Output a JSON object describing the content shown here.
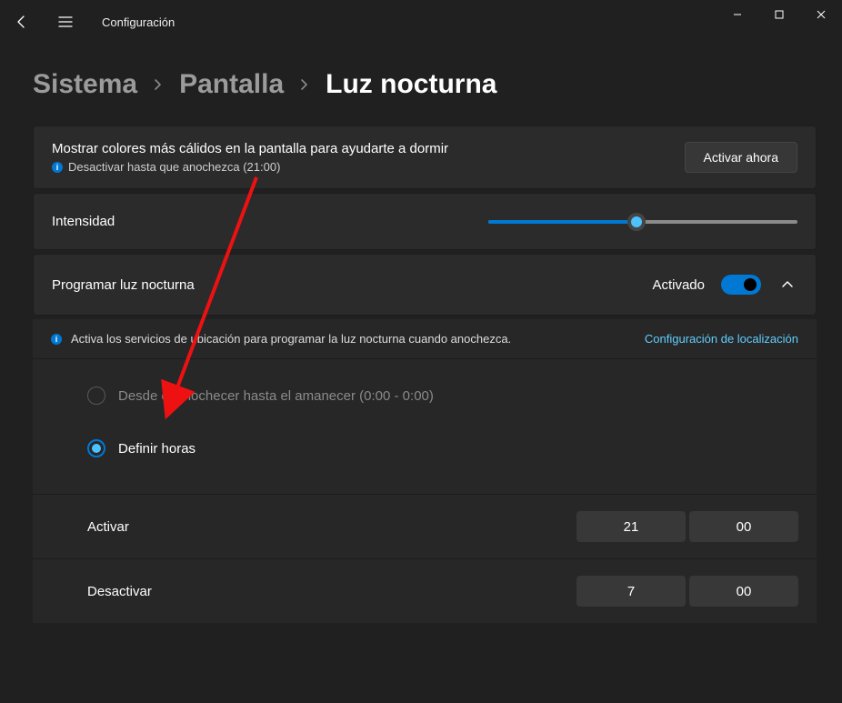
{
  "window": {
    "title": "Configuración"
  },
  "breadcrumb": {
    "system": "Sistema",
    "display": "Pantalla",
    "nightlight": "Luz nocturna"
  },
  "intro": {
    "line1": "Mostrar colores más cálidos en la pantalla para ayudarte a dormir",
    "line2": "Desactivar hasta que anochezca (21:00)",
    "button": "Activar ahora"
  },
  "strength": {
    "label": "Intensidad",
    "value_pct": 48
  },
  "schedule": {
    "label": "Programar luz nocturna",
    "state": "Activado",
    "info_text": "Activa los servicios de ubicación para programar la luz nocturna cuando anochezca.",
    "info_link": "Configuración de localización",
    "option_sunset": "Desde el anochecer hasta el amanecer (0:00 - 0:00)",
    "option_hours": "Definir horas"
  },
  "times": {
    "turn_on_label": "Activar",
    "turn_on_h": "21",
    "turn_on_m": "00",
    "turn_off_label": "Desactivar",
    "turn_off_h": "7",
    "turn_off_m": "00"
  }
}
